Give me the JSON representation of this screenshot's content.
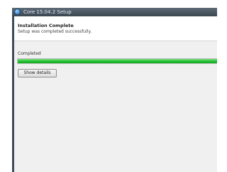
{
  "window": {
    "title": "Core 15.04.2 Setup"
  },
  "header": {
    "title": "Installation Complete",
    "subtitle": "Setup was completed successfully."
  },
  "progress": {
    "label": "Completed",
    "fraction": 1.0
  },
  "buttons": {
    "show_details": "Show details"
  },
  "colors": {
    "progress_fill": "#1fbf2f",
    "title_bar": "#3f4b56"
  }
}
